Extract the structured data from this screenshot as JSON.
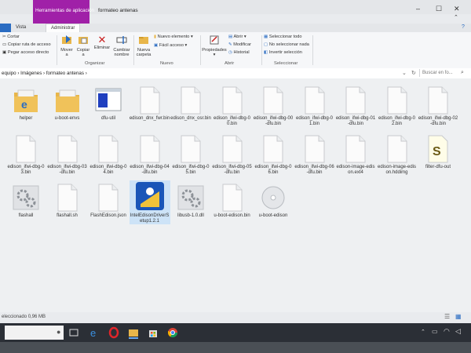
{
  "window": {
    "context_tab_label": "Herramientas de aplicación",
    "title": "formateo antenas"
  },
  "ribbon_tabs": [
    "Vista",
    "Administrar"
  ],
  "ribbon": {
    "clipboard": {
      "cut": "Cortar",
      "copy_path": "Copiar ruta de acceso",
      "paste_shortcut": "Pegar acceso directo"
    },
    "organize": {
      "move_to": [
        "Mover",
        "a"
      ],
      "copy_to": [
        "Copiar",
        "a"
      ],
      "delete": "Eliminar",
      "rename": [
        "Cambiar",
        "nombre"
      ],
      "group": "Organizar"
    },
    "new": {
      "new_folder": [
        "Nueva",
        "carpeta"
      ],
      "new_item": "Nuevo elemento",
      "easy_access": "Fácil acceso",
      "group": "Nuevo"
    },
    "open": {
      "properties": "Propiedades",
      "open": "Abrir",
      "edit": "Modificar",
      "history": "Historial",
      "group": "Abrir"
    },
    "select": {
      "select_all": "Seleccionar todo",
      "select_none": "No seleccionar nada",
      "invert": "Invertir selección",
      "group": "Seleccionar"
    }
  },
  "address": {
    "segments": [
      "equipo",
      "Imágenes",
      "formateo antenas"
    ],
    "search_placeholder": "Buscar en fo..."
  },
  "files": [
    {
      "name": "helper",
      "type": "folder-ie"
    },
    {
      "name": "u-boot-envs",
      "type": "folder"
    },
    {
      "name": "dfu-util",
      "type": "app"
    },
    {
      "name": "edison_dnx_fwr.bin",
      "type": "doc"
    },
    {
      "name": "edison_dnx_osr.bin",
      "type": "doc"
    },
    {
      "name": "edison_ifwi-dbg-00.bin",
      "type": "doc"
    },
    {
      "name": "edison_ifwi-dbg-00-dfu.bin",
      "type": "doc"
    },
    {
      "name": "edison_ifwi-dbg-01.bin",
      "type": "doc"
    },
    {
      "name": "edison_ifwi-dbg-01-dfu.bin",
      "type": "doc"
    },
    {
      "name": "edison_ifwi-dbg-02.bin",
      "type": "doc"
    },
    {
      "name": "edison_ifwi-dbg-02-dfu.bin",
      "type": "doc"
    },
    {
      "name": "edison_ifwi-dbg-03.bin",
      "type": "doc"
    },
    {
      "name": "edison_ifwi-dbg-03-dfu.bin",
      "type": "doc"
    },
    {
      "name": "edison_ifwi-dbg-04.bin",
      "type": "doc"
    },
    {
      "name": "edison_ifwi-dbg-04-dfu.bin",
      "type": "doc"
    },
    {
      "name": "edison_ifwi-dbg-05.bin",
      "type": "doc"
    },
    {
      "name": "edison_ifwi-dbg-05-dfu.bin",
      "type": "doc"
    },
    {
      "name": "edison_ifwi-dbg-06.bin",
      "type": "doc"
    },
    {
      "name": "edison_ifwi-dbg-06-dfu.bin",
      "type": "doc"
    },
    {
      "name": "edison-image-edison.ext4",
      "type": "doc"
    },
    {
      "name": "edison-image-edison.hddimg",
      "type": "doc"
    },
    {
      "name": "filter-dfu-out",
      "type": "script"
    },
    {
      "name": "flashall",
      "type": "gear"
    },
    {
      "name": "flashall.sh",
      "type": "doc"
    },
    {
      "name": "FlashEdison.json",
      "type": "doc"
    },
    {
      "name": "IntelEdisonDriverSetup1.2.1",
      "type": "installer"
    },
    {
      "name": "libusb-1.0.dll",
      "type": "gear"
    },
    {
      "name": "u-boot-edison.bin",
      "type": "doc"
    },
    {
      "name": "u-boot-edison",
      "type": "disc"
    }
  ],
  "status": {
    "text": "eleccionado  0,96 MB"
  },
  "colors": {
    "context_tab": "#a020a8",
    "selection": "#cde3f7",
    "taskbar": "#2b2f36"
  }
}
